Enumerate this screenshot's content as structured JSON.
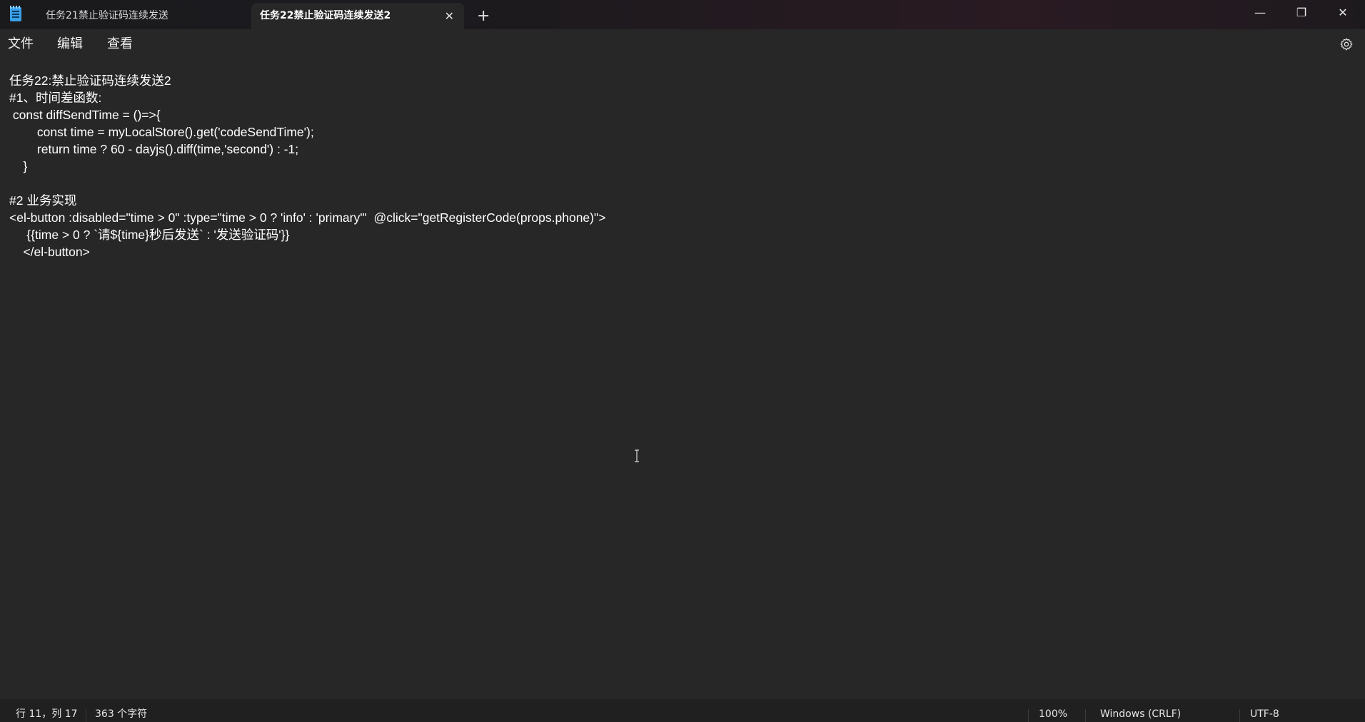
{
  "titlebar": {
    "tabs": [
      {
        "label": "任务21禁止验证码连续发送",
        "active": false
      },
      {
        "label": "任务22禁止验证码连续发送2",
        "active": true
      }
    ],
    "close_tab_glyph": "✕",
    "add_tab_glyph": "+",
    "window_controls": {
      "minimize": "—",
      "maximize": "❐",
      "close": "✕"
    }
  },
  "menubar": {
    "file": "文件",
    "edit": "编辑",
    "view": "查看"
  },
  "editor": {
    "content": "任务22:禁止验证码连续发送2\n#1、时间差函数:\n const diffSendTime = ()=>{\n        const time = myLocalStore().get('codeSendTime');\n        return time ? 60 - dayjs().diff(time,'second') : -1;\n    }\n\n#2 业务实现\n<el-button :disabled=\"time > 0\" :type=\"time > 0 ? 'info' : 'primary'\"  @click=\"getRegisterCode(props.phone)\">\n     {{time > 0 ? `请${time}秒后发送` : '发送验证码'}}\n    </el-button>"
  },
  "statusbar": {
    "position": "行 11，列 17",
    "char_count": "363 个字符",
    "zoom": "100%",
    "line_ending": "Windows (CRLF)",
    "encoding": "UTF-8"
  },
  "colors": {
    "editor_bg": "#272727",
    "titlebar_bg": "#1c1a1e",
    "statusbar_bg": "#202020",
    "text": "#ffffff"
  },
  "icons": {
    "app": "notepad-icon",
    "settings": "gear-icon",
    "cursor": "text-cursor-icon"
  }
}
